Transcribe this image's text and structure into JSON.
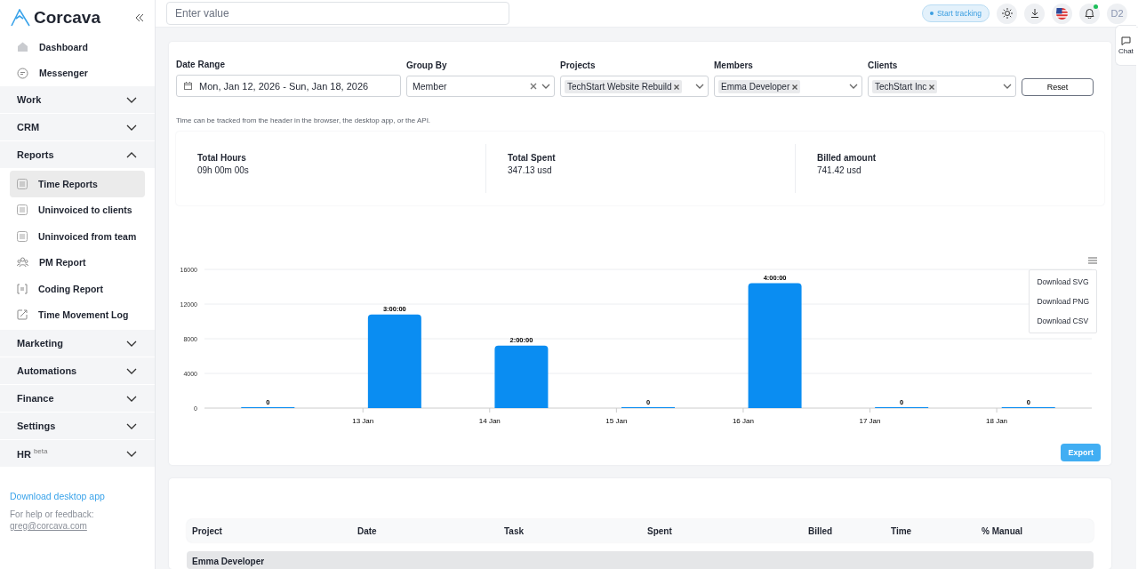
{
  "sidebar": {
    "brand": "Corcava",
    "items": [
      {
        "kind": "link",
        "label": "Dashboard",
        "selected": false
      },
      {
        "kind": "link",
        "label": "Messenger",
        "selected": false
      },
      {
        "kind": "section",
        "label": "Work",
        "expanded": false
      },
      {
        "kind": "section",
        "label": "CRM",
        "expanded": false
      },
      {
        "kind": "section",
        "label": "Reports",
        "expanded": true,
        "children": [
          {
            "label": "Time Reports",
            "selected": true
          },
          {
            "label": "Uninvoiced to clients",
            "selected": false
          },
          {
            "label": "Uninvoiced from team",
            "selected": false
          },
          {
            "label": "PM Report",
            "selected": false
          },
          {
            "label": "Coding Report",
            "selected": false
          },
          {
            "label": "Time Movement Log",
            "selected": false
          }
        ]
      },
      {
        "kind": "section",
        "label": "Marketing",
        "expanded": false
      },
      {
        "kind": "section",
        "label": "Automations",
        "expanded": false
      },
      {
        "kind": "section",
        "label": "Finance",
        "expanded": false
      },
      {
        "kind": "section",
        "label": "Settings",
        "expanded": false
      },
      {
        "kind": "section",
        "label": "HR",
        "badge": "beta",
        "expanded": false
      }
    ],
    "download_link": "Download desktop app",
    "help_text": "For help or feedback:",
    "help_email": "greg@corcava.com"
  },
  "header": {
    "search": {
      "placeholder": "Enter value"
    },
    "start_tracking": "Start tracking",
    "avatar": "D2"
  },
  "chat_tab": "Chat",
  "filters": {
    "date_range": {
      "label": "Date Range",
      "value": "Mon, Jan 12, 2026 - Sun, Jan 18, 2026"
    },
    "group_by": {
      "label": "Group By",
      "value": "Member"
    },
    "projects": {
      "label": "Projects",
      "tags": [
        "TechStart Website Rebuild"
      ]
    },
    "members": {
      "label": "Members",
      "tags": [
        "Emma Developer"
      ]
    },
    "clients": {
      "label": "Clients",
      "tags": [
        "TechStart Inc"
      ]
    },
    "reset": "Reset"
  },
  "note": "Time can be tracked from the header in the browser, the desktop app, or the API.",
  "stats": [
    {
      "label": "Total Hours",
      "value": "09h 00m 00s"
    },
    {
      "label": "Total Spent",
      "value": "347.13 usd"
    },
    {
      "label": "Billed amount",
      "value": "741.42 usd"
    }
  ],
  "chart": {
    "menu": [
      "Download SVG",
      "Download PNG",
      "Download CSV"
    ],
    "export": "Export",
    "chart_data": {
      "type": "bar",
      "values": [
        0,
        10800,
        7200,
        0,
        14400,
        0,
        0
      ],
      "ylim": [
        0,
        16000
      ],
      "yticks": [
        0,
        4000,
        8000,
        12000,
        16000
      ],
      "grid": true,
      "categories": [
        null,
        "13 Jan",
        "14 Jan",
        "15 Jan",
        "16 Jan",
        "17 Jan",
        "18 Jan"
      ],
      "value_labels": [
        "0",
        "3:00:00",
        "2:00:00",
        "0",
        "4:00:00",
        "0",
        "0"
      ]
    }
  },
  "table": {
    "columns": [
      "Project",
      "Date",
      "Task",
      "Spent",
      "Billed",
      "Time",
      "% Manual"
    ],
    "group": "Emma Developer"
  }
}
